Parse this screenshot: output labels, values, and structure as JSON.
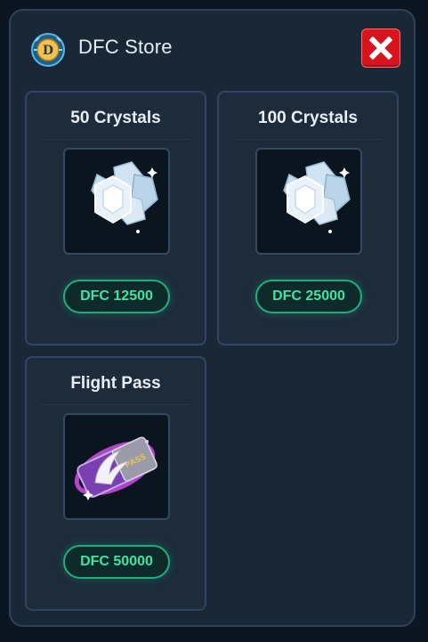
{
  "header": {
    "title": "DFC Store",
    "logo_icon": "dfc-coin-logo-icon",
    "close_icon": "close-icon"
  },
  "colors": {
    "close_button": "#d8151e",
    "price_accent": "#3fe3a4",
    "panel_bg": "#1a2736"
  },
  "items": [
    {
      "title": "50 Crystals",
      "price": "DFC 12500",
      "icon": "crystal-icon"
    },
    {
      "title": "100 Crystals",
      "price": "DFC 25000",
      "icon": "crystal-icon"
    },
    {
      "title": "Flight Pass",
      "price": "DFC 50000",
      "icon": "flight-pass-icon"
    }
  ]
}
